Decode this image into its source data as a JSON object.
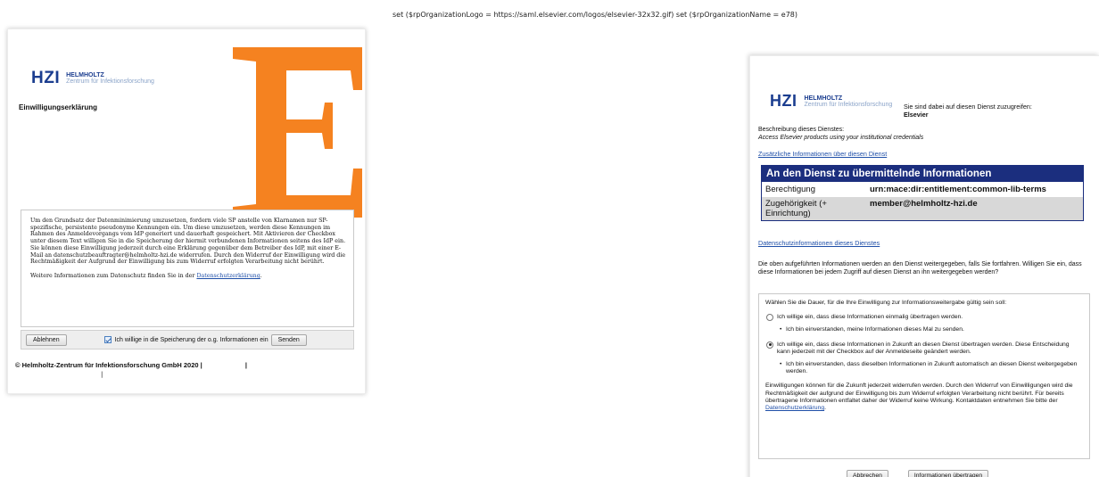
{
  "top_debug": "set ($rpOrganizationLogo = https://saml.elsevier.com/logos/elsevier-32x32.gif) set ($rpOrganizationName = e78)",
  "brand": {
    "hzi": "HZI",
    "helmholtz": "HELMHOLTZ",
    "subtitle": "Zentrum für Infektionsforschung",
    "logo_color": "#1b3d8f",
    "sp_logo_letter": "E",
    "sp_logo_color": "#f58220"
  },
  "left": {
    "title": "Einwilligungserklärung",
    "consent_text": "Um den Grundsatz der Datenminimierung umzusetzen, fordern viele SP anstelle von Klarnamen nur SP-spezifische, persistente pseudonyme Kennungen ein. Um diese umzusetzen, werden diese Kennungen im Rahmen des Anmeldevorgangs vom IdP generiert und dauerhaft gespeichert. Mit Aktivieren der Checkbox unter diesem Text willigen Sie in die Speicherung der hiermit verbundenen Informationen seitens des IdP ein. Sie können diese Einwilligung jederzeit durch eine Erklärung gegenüber dem Betreiber des IdP, mit einer E-Mail an datenschutzbeauftragter@helmholtz-hzi.de widerrufen. Durch den Widerruf der Einwilligung wird die Rechtmäßigkeit der Aufgrund der Einwilligung bis zum Widerruf erfolgten Verarbeitung nicht berührt.",
    "more_prefix": "Weitere Informationen zum Datenschutz finden Sie in der",
    "more_link": "Datenschutzerklärung",
    "more_suffix": ".",
    "reject_label": "Ablehnen",
    "checkbox_label": "Ich willige in die Speicherung der o.g. Informationen ein",
    "checkbox_checked": true,
    "send_label": "Senden",
    "footer": "© Helmholtz-Zentrum für Infektionsforschung GmbH 2020 |",
    "footer_sep": "|",
    "footer_mark": "|"
  },
  "right": {
    "access_intro": "Sie sind dabei auf diesen Dienst zuzugreifen:",
    "service_name": "Elsevier",
    "desc_label": "Beschreibung dieses Dienstes:",
    "desc_text": "Access Elsevier products using your institutional credentials",
    "more_info_link": "Zusätzliche Informationen über diesen Dienst",
    "table_header": "An den Dienst zu übermittelnde Informationen",
    "table_header_color": "#1b2e7e",
    "attributes": [
      {
        "name": "Berechtigung",
        "value": "urn:mace:dir:entitlement:common-lib-terms"
      },
      {
        "name": "Zugehörigkeit (+ Einrichtung)",
        "value": "member@helmholtz-hzi.de"
      }
    ],
    "privacy_link": "Datenschutzinformationen dieses Dienstes",
    "info_text": "Die oben aufgeführten Informationen werden an den Dienst weitergegeben, falls Sie fortfahren. Willigen Sie ein, dass diese Informationen bei jedem Zugriff auf diesen Dienst an ihn weitergegeben werden?",
    "duration_prompt": "Wählen Sie die Dauer, für die Ihre Einwilligung zur Informationsweitergabe gültig sein soll:",
    "option_once": "Ich willige ein, dass diese Informationen einmalig übertragen werden.",
    "option_once_selected": false,
    "option_once_bullet": "Ich bin einverstanden, meine Informationen dieses Mal zu senden.",
    "option_future": "Ich willige ein, dass diese Informationen in Zukunft an diesen Dienst übertragen werden. Diese Entscheidung kann jederzeit mit der Checkbox auf der Anmeldeseite geändert werden.",
    "option_future_selected": true,
    "option_future_bullet": "Ich bin einverstanden, dass dieselben Informationen in Zukunft automatisch an diesen Dienst weitergegeben werden.",
    "revoke_text": "Einwilligungen können für die Zukunft jederzeit widerrufen werden. Durch den Widerruf von Einwilligungen wird die Rechtmäßigkeit der aufgrund der Einwilligung bis zum Widerruf erfolgten Verarbeitung nicht berührt. Für bereits übertragene Informationen entfaltet daher der Widerruf keine Wirkung. Kontaktdaten entnehmen Sie bitte der",
    "revoke_link": "Datenschutzerklärung",
    "revoke_suffix": ".",
    "cancel_label": "Abbrechen",
    "transfer_label": "Informationen übertragen"
  }
}
